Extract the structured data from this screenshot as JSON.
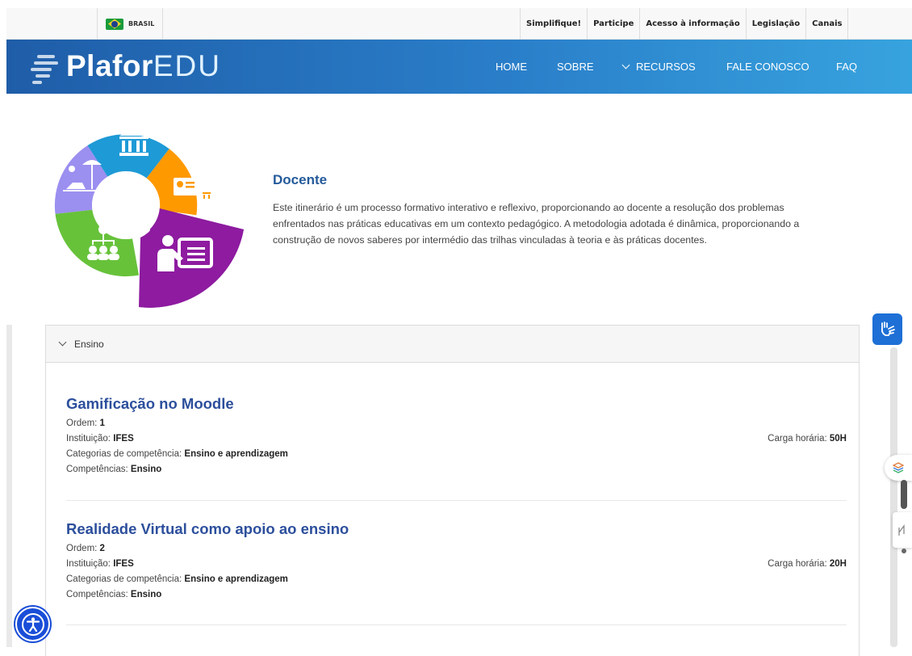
{
  "gov_bar": {
    "brasil_label": "BRASIL",
    "links": [
      "Simplifique!",
      "Participe",
      "Acesso à informação",
      "Legislação",
      "Canais"
    ]
  },
  "header": {
    "logo_main": "Plafor",
    "logo_edu": "EDU",
    "nav": {
      "home": "HOME",
      "sobre": "SOBRE",
      "recursos": "RECURSOS",
      "fale_conosco": "FALE CONOSCO",
      "faq": "FAQ"
    }
  },
  "hero": {
    "title": "Docente",
    "description": "Este itinerário é um processo formativo interativo e reflexivo, proporcionando ao docente a resolução dos problemas enfrentados nas práticas educativas em um contexto pedagógico. A metodologia adotada é dinâmica, proporcionando a construção de novos saberes por intermédio das trilhas vinculadas à teoria e às práticas docentes.",
    "wheel_colors": {
      "institution": "#1e9ad6",
      "profile": "#ff9900",
      "teacher": "#8e1ba0",
      "hierarchy": "#67c23a",
      "leisure": "#9b8ff0"
    }
  },
  "accordion": {
    "section_label": "Ensino",
    "courses": [
      {
        "title": "Gamificação no Moodle",
        "ordem_label": "Ordem:",
        "ordem": "1",
        "instituicao_label": "Instituição:",
        "instituicao": "IFES",
        "categorias_label": "Categorias de competência:",
        "categorias": "Ensino e aprendizagem",
        "competencias_label": "Competências:",
        "competencias": "Ensino",
        "carga_label": "Carga horária:",
        "carga": "50H"
      },
      {
        "title": "Realidade Virtual como apoio ao ensino",
        "ordem_label": "Ordem:",
        "ordem": "2",
        "instituicao_label": "Instituição:",
        "instituicao": "IFES",
        "categorias_label": "Categorias de competência:",
        "categorias": "Ensino e aprendizagem",
        "competencias_label": "Competências:",
        "competencias": "Ensino",
        "carga_label": "Carga horária:",
        "carga": "20H"
      }
    ]
  },
  "widgets": {
    "vlibras_icon": "sign-language-hands-icon",
    "accessibility_icon": "accessibility-person-icon"
  }
}
